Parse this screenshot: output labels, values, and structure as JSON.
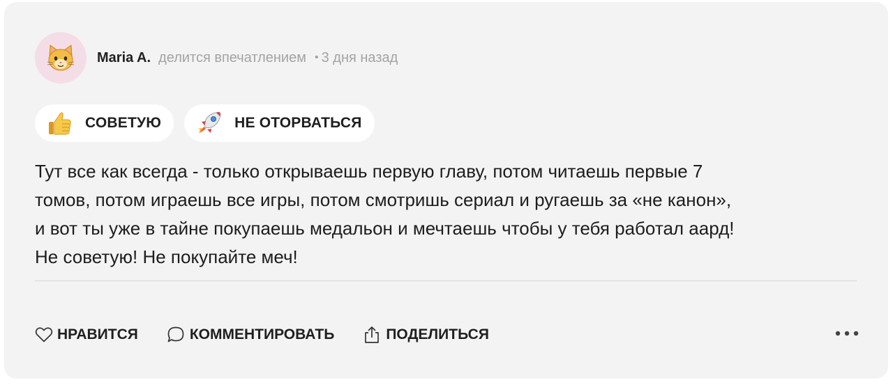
{
  "post": {
    "author": "Maria A.",
    "action_text": "делится впечатлением",
    "separator": "•",
    "time": "3 дня назад",
    "avatar_icon": "cat-face-icon",
    "avatar_bg": "#f4dde6"
  },
  "tags": [
    {
      "label": "СОВЕТУЮ",
      "icon": "thumbs-up-icon"
    },
    {
      "label": "НЕ ОТОРВАТЬСЯ",
      "icon": "rocket-icon"
    }
  ],
  "review": {
    "lines": [
      "Тут все как всегда - только открываешь первую главу, потом читаешь первые 7",
      "томов, потом играешь все игры, потом смотришь сериал и ругаешь за «не канон»,",
      "и вот ты уже в тайне покупаешь медальон и мечтаешь чтобы у тебя работал аард!",
      "Не советую! Не покупайте меч!"
    ]
  },
  "actions": {
    "like_label": "НРАВИТСЯ",
    "comment_label": "КОММЕНТИРОВАТЬ",
    "share_label": "ПОДЕЛИТЬСЯ",
    "more_icon": "more-horizontal-icon"
  },
  "colors": {
    "card_bg": "#f3f3f3",
    "muted_text": "#a3a3a3",
    "text": "#1d1d1d"
  }
}
